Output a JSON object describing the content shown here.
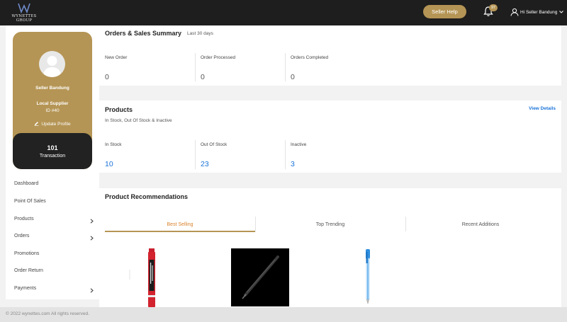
{
  "header": {
    "logo_text": "WYNETTES GROUP",
    "help_label": "Seller Help",
    "notification_count": "97",
    "user_label": "Hi Seller Bandung"
  },
  "profile": {
    "name": "Seller Bandung",
    "role": "Local Supplier",
    "id": "ID #40",
    "update_label": "Update Profile",
    "transactions_count": "101",
    "transactions_label": "Transaction"
  },
  "sidebar": {
    "items": [
      {
        "label": "Dashboard",
        "has_children": false
      },
      {
        "label": "Point Of Sales",
        "has_children": false
      },
      {
        "label": "Products",
        "has_children": true
      },
      {
        "label": "Orders",
        "has_children": true
      },
      {
        "label": "Promotions",
        "has_children": false
      },
      {
        "label": "Order Return",
        "has_children": false
      },
      {
        "label": "Payments",
        "has_children": true
      }
    ]
  },
  "orders_summary": {
    "title": "Orders & Sales Summary",
    "period": "Last 30 days",
    "stats": [
      {
        "label": "New Order",
        "value": "0"
      },
      {
        "label": "Order Processed",
        "value": "0"
      },
      {
        "label": "Orders Completed",
        "value": "0"
      }
    ]
  },
  "products_summary": {
    "title": "Products",
    "subtitle": "In Stock, Out Of Stock & Inactive",
    "link_label": "View Details",
    "stats": [
      {
        "label": "In Stock",
        "value": "10"
      },
      {
        "label": "Out Of Stock",
        "value": "23"
      },
      {
        "label": "Inactive",
        "value": "3"
      }
    ]
  },
  "recommendations": {
    "title": "Product Recommendations",
    "tabs": [
      {
        "label": "Best Selling",
        "active": true
      },
      {
        "label": "Top Trending",
        "active": false
      },
      {
        "label": "Recent Additions",
        "active": false
      }
    ]
  },
  "footer": {
    "copyright": "© 2022 wynettes.com All rights reserved."
  },
  "colors": {
    "brand_gold": "#b59555",
    "topbar": "#1e1e1e",
    "link_blue": "#1a73d9",
    "active_tab": "#d9822b"
  }
}
